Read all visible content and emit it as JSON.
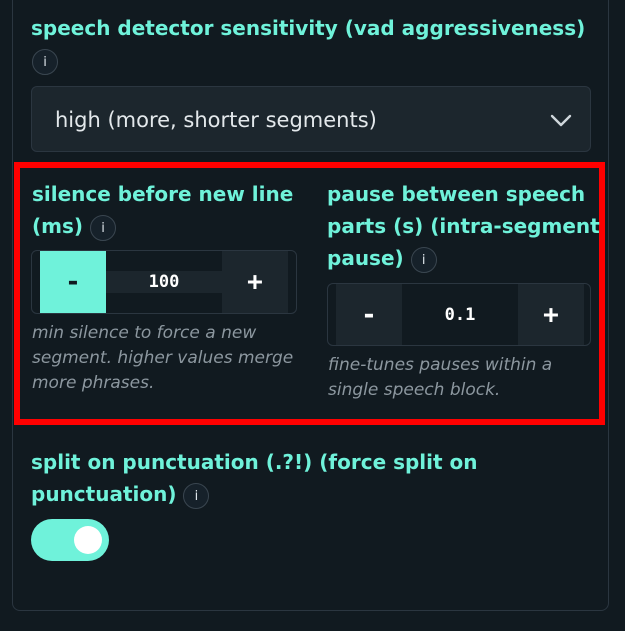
{
  "vad": {
    "label": "speech detector sensitivity (vad aggressiveness)",
    "info": "i",
    "selected": "high (more, shorter segments)"
  },
  "silence": {
    "label_line1": "silence before new line",
    "label_line2": "(ms)",
    "info": "i",
    "minus": "-",
    "value": "100",
    "plus": "+",
    "help": [
      "min silence to force a new",
      "segment. higher values merge",
      "more phrases."
    ]
  },
  "pause": {
    "label_line1": "pause between speech",
    "label_line2": "parts (s) (intra-segment",
    "label_line3": "pause)",
    "info": "i",
    "minus": "-",
    "value": "0.1",
    "plus": "+",
    "help": [
      "fine-tunes pauses within a",
      "single speech block."
    ]
  },
  "split": {
    "label_line1": "split on punctuation (.?!) (force split on",
    "label_line2": "punctuation)",
    "info": "i",
    "enabled": true
  },
  "colors": {
    "accent": "#6ff2da",
    "background": "#111a20",
    "highlight_box": "#ff0000"
  }
}
